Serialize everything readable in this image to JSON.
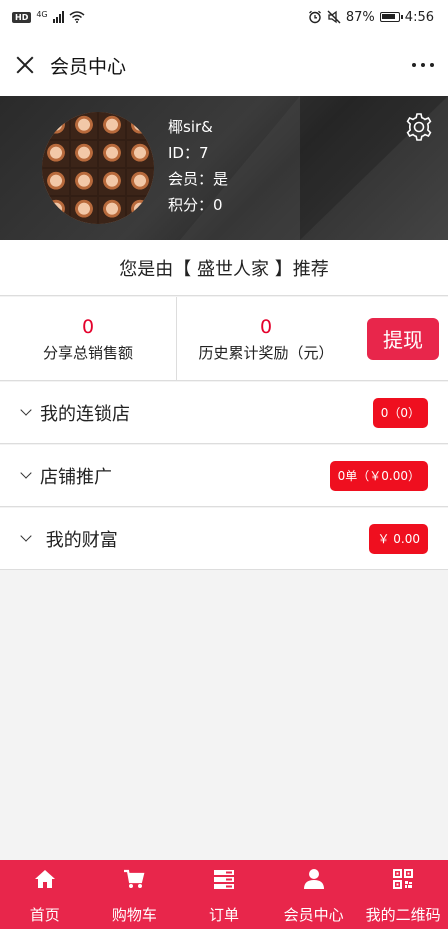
{
  "status_bar": {
    "hd": "HD",
    "network": "4G",
    "battery": "87%",
    "battery_level": 0.87,
    "time": "4:56"
  },
  "titlebar": {
    "title": "会员中心"
  },
  "profile": {
    "name": "椰sir&",
    "id_line": "ID：7",
    "member_line": "会员：是",
    "points_line": "积分：0"
  },
  "referral": {
    "text": "您是由【 盛世人家 】推荐"
  },
  "stats": {
    "share_sales_value": "0",
    "share_sales_label": "分享总销售额",
    "history_reward_value": "0",
    "history_reward_label": "历史累计奖励（元）",
    "withdraw_label": "提现"
  },
  "rows": [
    {
      "label": "我的连锁店",
      "badge": "0（0）"
    },
    {
      "label": "店铺推广",
      "badge": "0单（￥0.00）"
    },
    {
      "label": " 我的财富",
      "badge": "￥ 0.00"
    }
  ],
  "bottom_nav": [
    {
      "label": "首页",
      "icon": "home-icon"
    },
    {
      "label": "购物车",
      "icon": "cart-icon"
    },
    {
      "label": "订单",
      "icon": "order-list-icon"
    },
    {
      "label": "会员中心",
      "icon": "user-icon"
    },
    {
      "label": "我的二维码",
      "icon": "qrcode-icon"
    }
  ],
  "colors": {
    "accent": "#e8264b",
    "badge_red": "#ef0f1f",
    "value_red": "#e4002b",
    "header_dark": "#333333"
  }
}
